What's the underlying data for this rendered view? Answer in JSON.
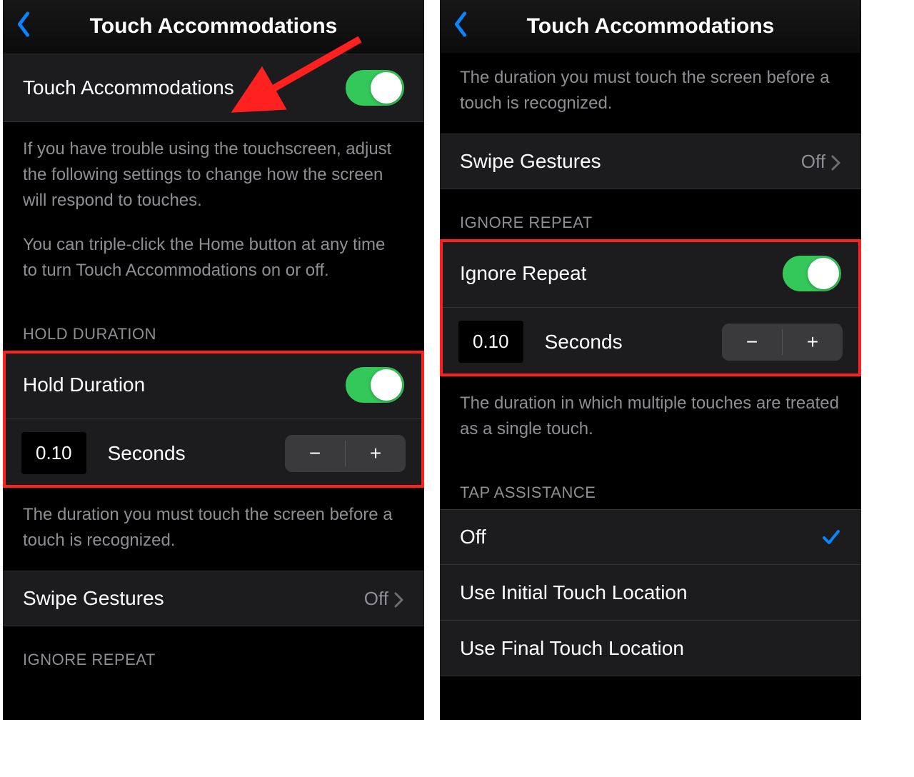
{
  "left": {
    "title": "Touch Accommodations",
    "main_toggle": {
      "label": "Touch Accommodations"
    },
    "desc1": "If you have trouble using the touchscreen, adjust the following settings to change how the screen will respond to touches.",
    "desc2": "You can triple-click the Home button at any time to turn Touch Accommodations on or off.",
    "hold_header": "HOLD DURATION",
    "hold_toggle": {
      "label": "Hold Duration"
    },
    "hold_value": "0.10",
    "seconds_label": "Seconds",
    "hold_footer": "The duration you must touch the screen before a touch is recognized.",
    "swipe_label": "Swipe Gestures",
    "swipe_value": "Off",
    "ignore_header": "IGNORE REPEAT"
  },
  "right": {
    "title": "Touch Accommodations",
    "hold_footer": "The duration you must touch the screen before a touch is recognized.",
    "swipe_label": "Swipe Gestures",
    "swipe_value": "Off",
    "ignore_header": "IGNORE REPEAT",
    "ignore_toggle": {
      "label": "Ignore Repeat"
    },
    "ignore_value": "0.10",
    "seconds_label": "Seconds",
    "ignore_footer": "The duration in which multiple touches are treated as a single touch.",
    "tap_header": "TAP ASSISTANCE",
    "tap_options": {
      "off": "Off",
      "initial": "Use Initial Touch Location",
      "final": "Use Final Touch Location"
    }
  },
  "icons": {
    "minus": "−",
    "plus": "+"
  }
}
